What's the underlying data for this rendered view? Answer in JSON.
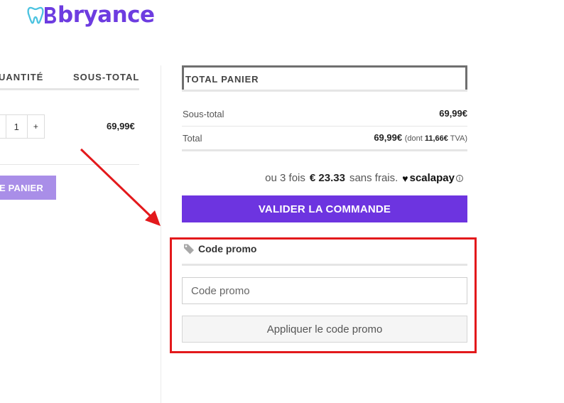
{
  "brand": {
    "name": "bryance",
    "color": "#6d3ce0"
  },
  "cart_table": {
    "qty_header": "UANTITÉ",
    "subtotal_header": "SOUS-TOTAL",
    "row": {
      "qty_minus": "",
      "qty_value": "1",
      "qty_plus": "+",
      "subtotal": "69,99€"
    },
    "update_button": "E PANIER"
  },
  "totals": {
    "title": "TOTAL PANIER",
    "subtotal_label": "Sous-total",
    "subtotal_value": "69,99€",
    "total_label": "Total",
    "total_value": "69,99€",
    "tax_prefix": "(dont",
    "tax_amount": "11,66€",
    "tax_suffix": "TVA)"
  },
  "scalapay": {
    "prefix": "ou 3 fois",
    "amount": "€ 23.33",
    "suffix": "sans frais.",
    "logo_text": "scalapay",
    "info_icon": "i"
  },
  "checkout_button": "VALIDER LA COMMANDE",
  "promo": {
    "title": "Code promo",
    "input_placeholder": "Code promo",
    "apply_button": "Appliquer le code promo",
    "icon": "tag-icon"
  },
  "colors": {
    "accent": "#6d34e0",
    "update_button": "#a98ee8",
    "annotation": "#e3191c"
  }
}
